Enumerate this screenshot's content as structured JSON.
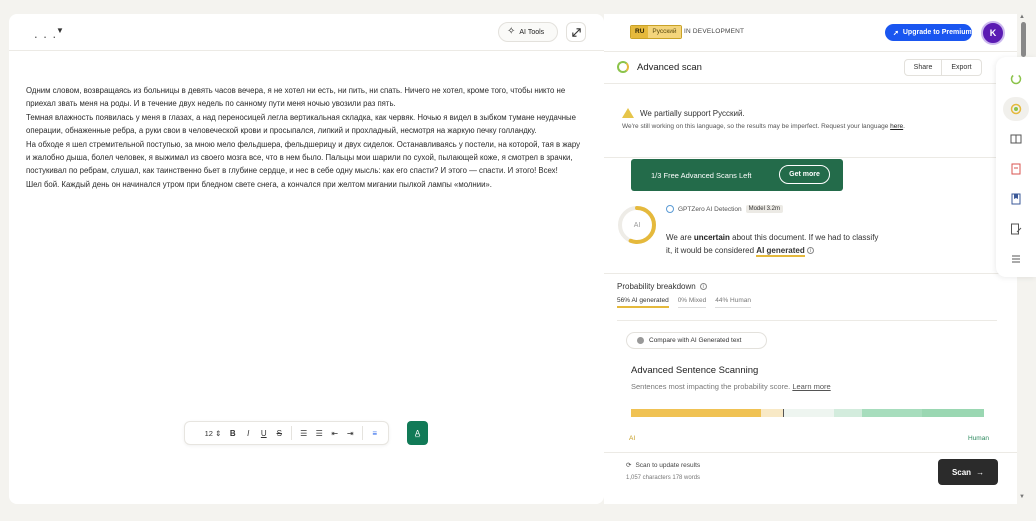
{
  "editor": {
    "title_placeholder": ". . .",
    "ai_tools_label": "AI Tools",
    "paragraphs": [
      "Одним словом, возвращаясь из больницы в девять часов вечера, я не хотел ни есть, ни пить, ни спать. Ничего не хотел, кроме того, чтобы никто не приехал звать меня на роды. И в течение двух недель по санному пути меня ночью увозили раз пять.",
      "Темная влажность появилась у меня в глазах, а над переносицей легла вертикальная складка, как червяк. Ночью я видел в зыбком тумане неудачные операции, обнаженные ребра, а руки свои в человеческой крови и просыпался, липкий и прохладный, несмотря на жаркую печку голландку.",
      "На обходе я шел стремительной поступью, за мною мело фельдшера, фельдшерицу и двух сиделок. Останавливаясь у постели, на которой, тая в жару и жалобно дыша, болел человек, я выжимал из своего мозга все, что в нем было. Пальцы мои шарили по сухой, пылающей коже, я смотрел в зрачки, постукивал по ребрам, слушал, как таинственно бьет в глубине сердце, и нес в себе одну мысль: как его спасти? И этого — спасти. И этого! Всех!",
      "Шел бой. Каждый день он начинался утром при бледном свете снега, а кончался при желтом мигании пылкой лампы «молнии»."
    ],
    "toolbar": {
      "font_size": "12",
      "bold": "B",
      "italic": "I",
      "underline": "U",
      "strike": "S"
    }
  },
  "panel": {
    "lang_code": "RU",
    "lang_name": "Русский",
    "in_development": "IN DEVELOPMENT",
    "upgrade_label": "Upgrade to Premium",
    "avatar_initial": "K",
    "scan_title": "Advanced scan",
    "share_label": "Share",
    "export_label": "Export",
    "warning_title": "We partially support Русский.",
    "warning_sub": "We're still working on this language, so the results may be imperfect. Request your language",
    "warning_link": "here",
    "promo_text": "1/3 Free Advanced Scans Left",
    "get_more_label": "Get more",
    "ring_label": "AI",
    "detector_name": "GPTZero AI Detection",
    "model_badge": "Model 3.2m",
    "verdict_prefix": "We are",
    "verdict_uncertain": "uncertain",
    "verdict_mid": "about this document. If we had to classify it, it would be considered",
    "verdict_result": "AI generated",
    "prob_title": "Probability breakdown",
    "prob_tabs": {
      "ai": "56% AI generated",
      "mixed": "0% Mixed",
      "human": "44% Human"
    },
    "compare_label": "Compare with AI Generated text",
    "adv_title": "Advanced Sentence Scanning",
    "adv_sub": "Sentences most impacting the probability score.",
    "adv_link": "Learn more",
    "bar_left_label": "AI",
    "bar_right_label": "Human",
    "scan_update": "Scan to update results",
    "counts": "1,057 characters  178 words",
    "scan_label": "Scan"
  },
  "probability": {
    "ai": 0.56,
    "mixed": 0.0,
    "human": 0.44
  },
  "colors": {
    "accent_green": "#236b4a",
    "ai_yellow": "#e5b93c",
    "human_green": "#8fd4ae",
    "upgrade_blue": "#1a56f0",
    "avatar_purple": "#5b1bb3"
  }
}
